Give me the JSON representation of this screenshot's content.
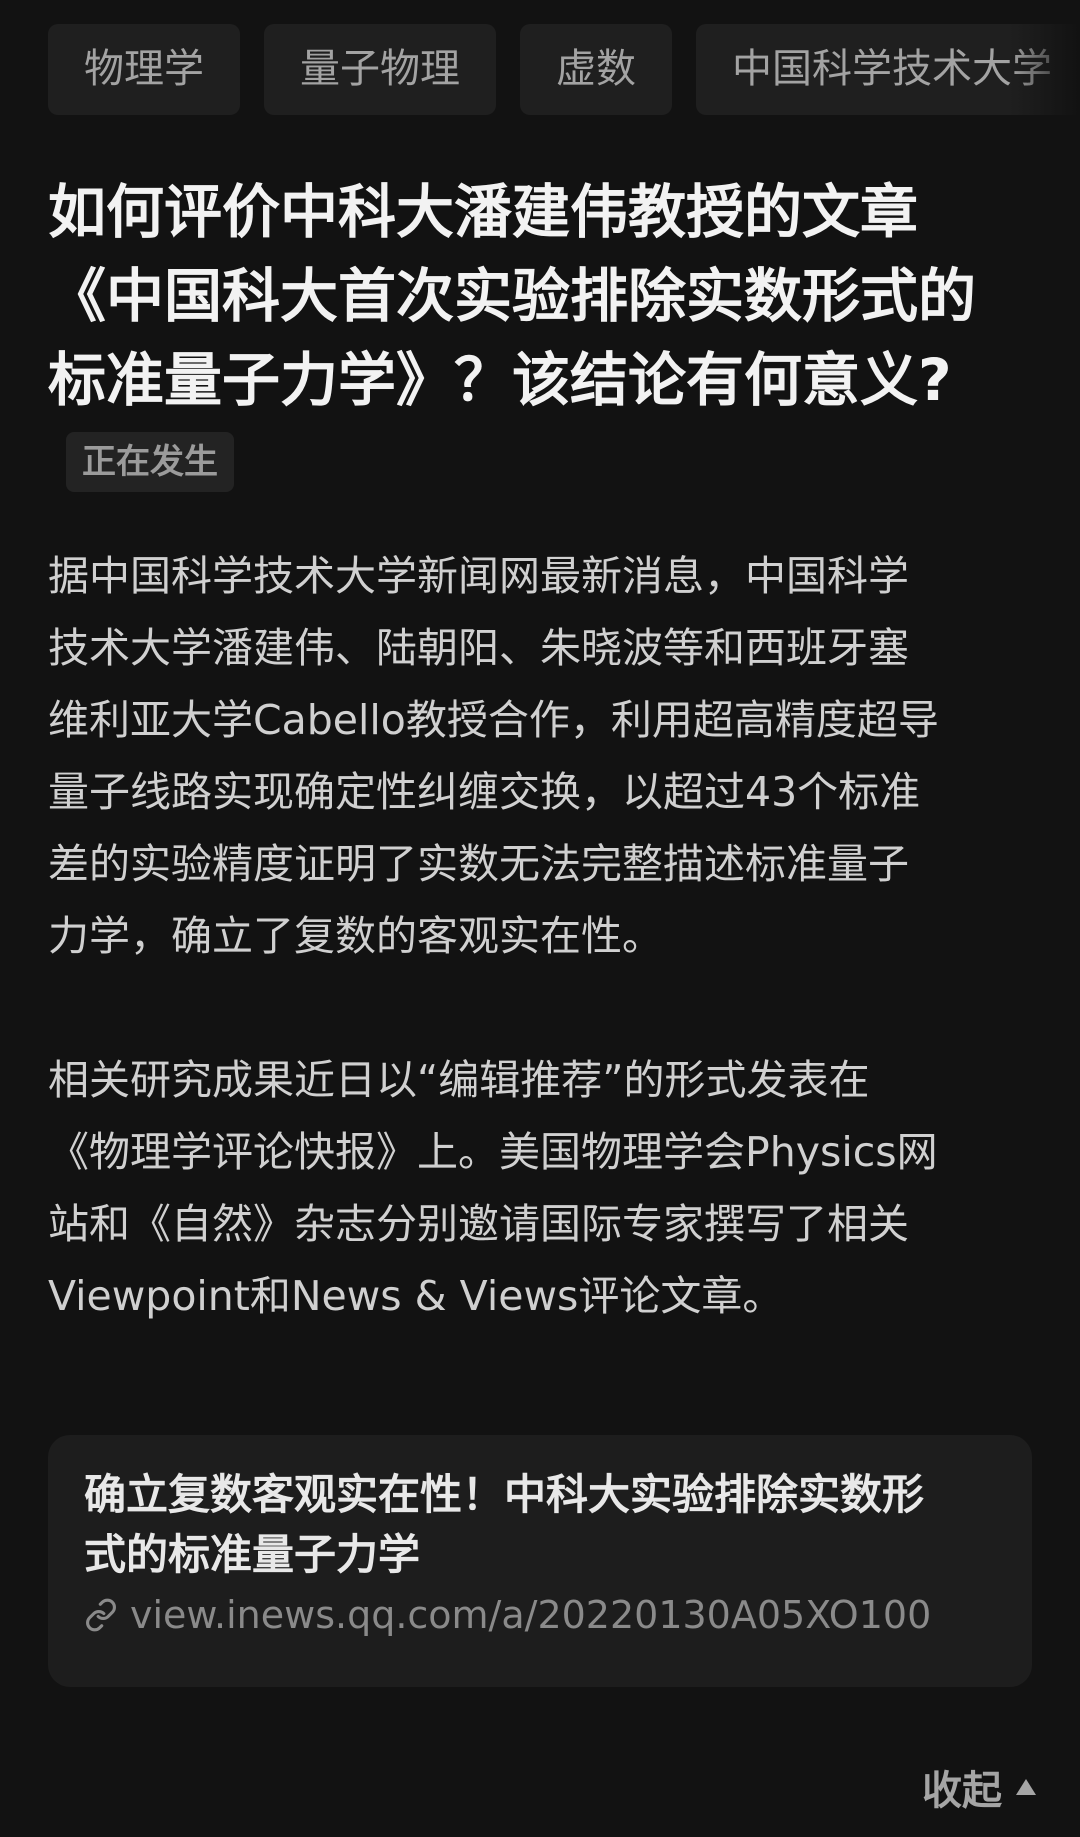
{
  "tags": [
    {
      "label": "物理学"
    },
    {
      "label": "量子物理"
    },
    {
      "label": "虚数"
    },
    {
      "label": "中国科学技术大学"
    }
  ],
  "question": {
    "title_lines": [
      "如何评价中科大潘建伟教授的文章",
      "《中国科大首次实验排除实数形式的",
      "标准量子力学》？该结论有何意义?"
    ],
    "badge": "正在发生"
  },
  "description": {
    "paragraphs": [
      {
        "lines": [
          "据中国科学技术大学新闻网最新消息，中国科学",
          "技术大学潘建伟、陆朝阳、朱晓波等和西班牙塞",
          "维利亚大学Cabello教授合作，利用超高精度超导",
          "量子线路实现确定性纠缠交换，以超过43个标准",
          "差的实验精度证明了实数无法完整描述标准量子",
          "力学，确立了复数的客观实在性。"
        ]
      },
      {
        "lines": [
          "相关研究成果近日以“编辑推荐”的形式发表在",
          "《物理学评论快报》上。美国物理学会Physics网",
          "站和《自然》杂志分别邀请国际专家撰写了相关",
          "Viewpoint和News & Views评论文章。"
        ]
      }
    ]
  },
  "link_card": {
    "title_lines": [
      "确立复数客观实在性！中科大实验排除实数形",
      "式的标准量子力学"
    ],
    "url": "view.inews.qq.com/a/20220130A05XO100",
    "icon": "link-icon"
  },
  "collapse": {
    "label": "收起",
    "icon": "triangle-up-icon"
  }
}
